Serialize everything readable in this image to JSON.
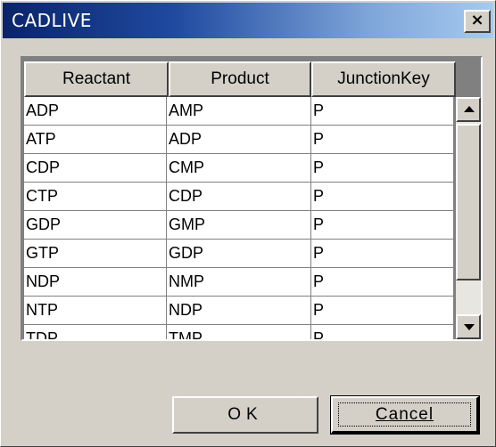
{
  "window": {
    "title": "CADLIVE",
    "close_glyph": "×"
  },
  "table": {
    "columns": [
      "Reactant",
      "Product",
      "JunctionKey"
    ],
    "rows": [
      [
        "ADP",
        "AMP",
        "P"
      ],
      [
        "ATP",
        "ADP",
        "P"
      ],
      [
        "CDP",
        "CMP",
        "P"
      ],
      [
        "CTP",
        "CDP",
        "P"
      ],
      [
        "GDP",
        "GMP",
        "P"
      ],
      [
        "GTP",
        "GDP",
        "P"
      ],
      [
        "NDP",
        "NMP",
        "P"
      ],
      [
        "NTP",
        "NDP",
        "P"
      ],
      [
        "TDP",
        "TMP",
        "P"
      ]
    ]
  },
  "buttons": {
    "ok_label": "OK",
    "cancel_label": "Cancel"
  },
  "icons": {
    "close": "close-icon",
    "scroll_up": "arrow-up-icon",
    "scroll_down": "arrow-down-icon"
  },
  "colors": {
    "titlebar_start": "#0a246a",
    "titlebar_end": "#a6caf0",
    "face": "#d4d0c8"
  }
}
